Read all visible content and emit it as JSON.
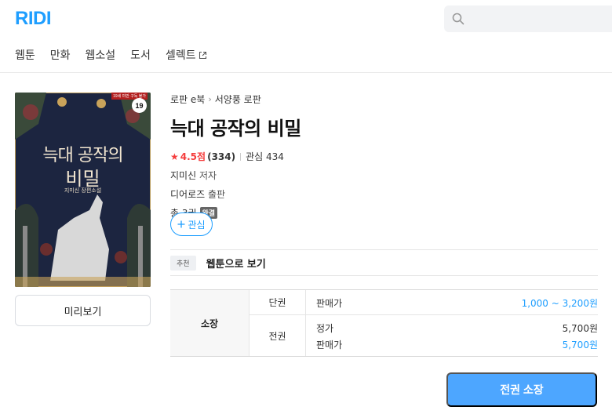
{
  "header": {
    "logo": "RIDI",
    "search_placeholder": ""
  },
  "nav": {
    "items": [
      {
        "label": "웹툰"
      },
      {
        "label": "만화"
      },
      {
        "label": "웹소설"
      },
      {
        "label": "도서"
      },
      {
        "label": "셀렉트"
      }
    ]
  },
  "cover": {
    "title_line1": "늑대 공작의",
    "title_line2": "비밀",
    "subtitle": "지미신 장편소설",
    "age_badge": "19",
    "adult_tag": "19세 미만 구독 불가"
  },
  "preview": {
    "label": "미리보기"
  },
  "book": {
    "breadcrumb": [
      "로판 e북",
      "서양풍 로판"
    ],
    "title": "늑대 공작의 비밀",
    "rating": "4.5점",
    "rating_count": "(334)",
    "interest": "관심 434",
    "author_name": "지미신",
    "author_role": "저자",
    "publisher_name": "디어로즈",
    "publisher_role": "출판",
    "volumes": "총 3권",
    "status_badge": "완결",
    "rating_color": "#f53d3d",
    "accent_color": "#1e9eff"
  },
  "wish_button": {
    "label": "관심"
  },
  "recommend": {
    "tag": "추천",
    "link": "웹툰으로 보기"
  },
  "price_table": {
    "own_label": "소장",
    "rows": [
      {
        "kind": "단권",
        "lines": [
          {
            "label": "판매가",
            "value": "1,000 ~ 3,200원"
          }
        ]
      },
      {
        "kind": "전권",
        "lines": [
          {
            "label": "정가",
            "value": "5,700원"
          },
          {
            "label": "판매가",
            "value": "5,700원"
          }
        ]
      }
    ]
  },
  "buy_button": {
    "label": "전권 소장",
    "color": "#4da6ff"
  }
}
